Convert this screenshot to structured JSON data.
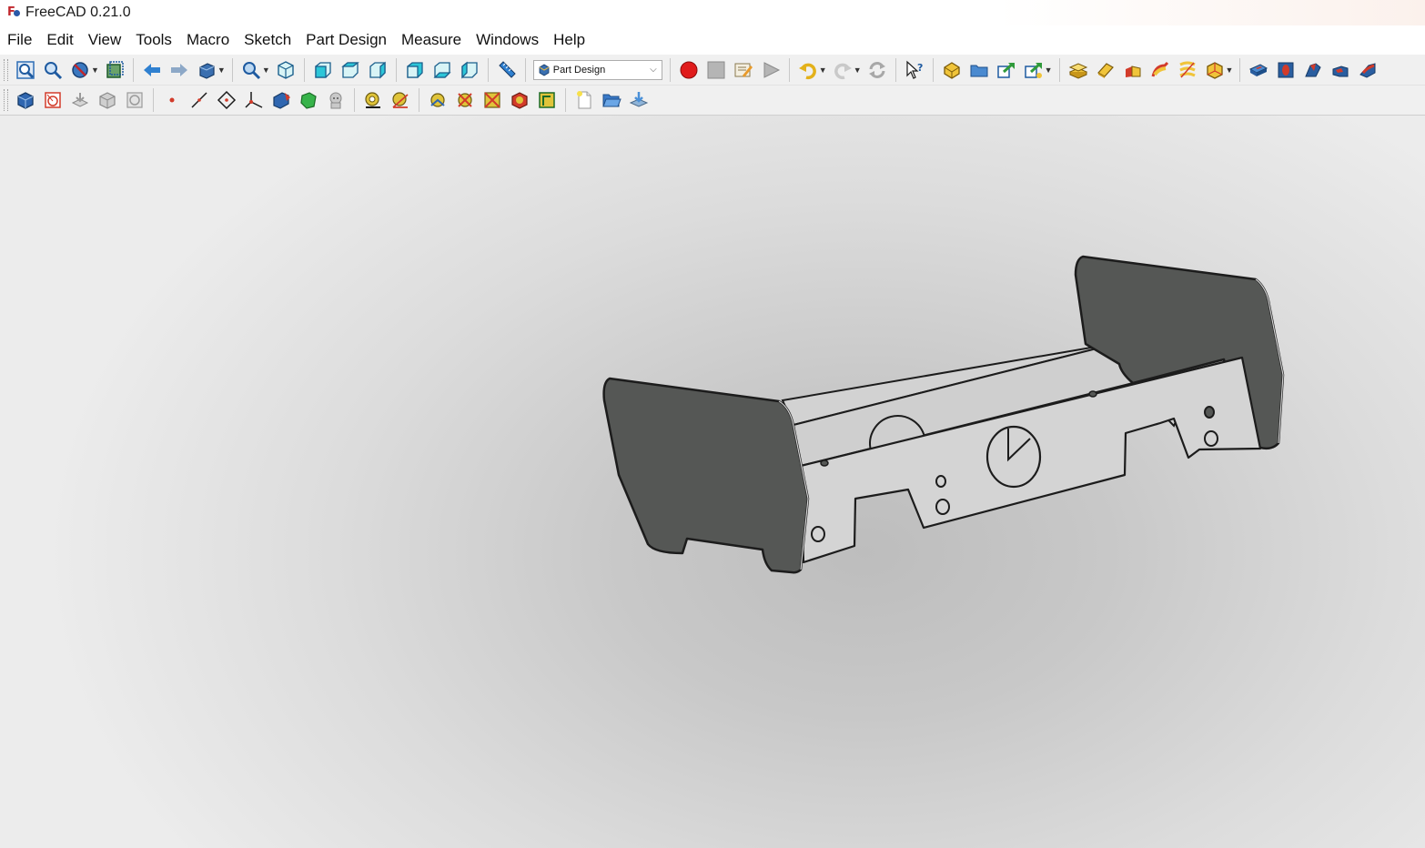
{
  "window": {
    "title": "FreeCAD 0.21.0"
  },
  "menubar": {
    "items": [
      "File",
      "Edit",
      "View",
      "Tools",
      "Macro",
      "Sketch",
      "Part Design",
      "Measure",
      "Windows",
      "Help"
    ]
  },
  "toolbar": {
    "workbench_selector": {
      "value": "Part Design"
    },
    "row1_icons": [
      "fit-all-icon",
      "fit-selection-icon",
      "draw-style-icon",
      "bounding-box-icon",
      "back-arrow-icon",
      "forward-arrow-icon",
      "std-views-icon",
      "zoom-icon",
      "isometric-icon",
      "front-view-icon",
      "top-view-icon",
      "right-view-icon",
      "rear-view-icon",
      "bottom-view-icon",
      "left-view-icon",
      "measure-distance-icon",
      "macro-record-icon",
      "macro-stop-icon",
      "macro-edit-icon",
      "macro-run-icon",
      "undo-icon",
      "redo-icon",
      "refresh-icon",
      "whats-this-icon",
      "create-part-icon",
      "create-group-icon",
      "make-link-icon",
      "link-actions-icon",
      "pad-icon",
      "revolution-icon",
      "additive-loft-icon",
      "additive-pipe-icon",
      "additive-helix-icon",
      "additive-primitive-icon",
      "pocket-icon",
      "hole-icon",
      "groove-icon",
      "subtractive-loft-icon",
      "subtractive-pipe-icon"
    ],
    "row2_icons": [
      "create-body-icon",
      "create-sketch-icon",
      "attach-sketch-icon",
      "validate-sketch-icon",
      "check-geometry-icon",
      "datum-point-icon",
      "datum-line-icon",
      "datum-plane-icon",
      "local-coordinate-icon",
      "shape-binder-icon",
      "subshape-binder-icon",
      "clone-icon",
      "measure-linear-icon",
      "measure-angular-icon",
      "measure-refresh-icon",
      "measure-clear-icon",
      "measure-toggle-all-icon",
      "measure-toggle-3d-icon",
      "measure-toggle-delta-icon",
      "new-document-icon",
      "open-document-icon",
      "save-document-icon"
    ]
  },
  "viewport": {
    "background_center": "#bdbdbd",
    "background_edge": "#ececec",
    "plate_color": "#555755",
    "bracket_color": "#cfcfcf",
    "edge_color": "#1c1c1c"
  }
}
